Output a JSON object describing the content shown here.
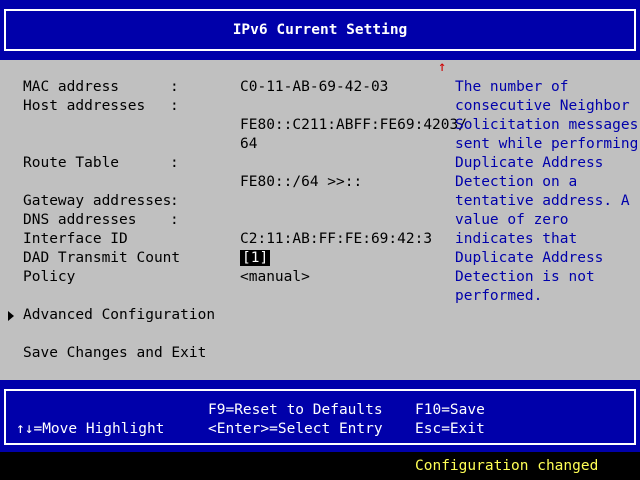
{
  "header": {
    "title": "IPv6 Current Setting"
  },
  "fields": [
    {
      "label": "MAC address",
      "colon": ":",
      "value": "C0-11-AB-69-42-03"
    },
    {
      "label": "Host addresses",
      "colon": ":",
      "value_line1": "FE80::C211:ABFF:FE69:4203/",
      "value_line2": "64"
    },
    {
      "label": "Route Table",
      "colon": ":",
      "value": "FE80::/64 >>::"
    },
    {
      "label": "Gateway addresses",
      "colon": ":"
    },
    {
      "label": "DNS addresses",
      "colon": ":"
    },
    {
      "label": "Interface ID",
      "value": "C2:11:AB:FF:FE:69:42:3"
    },
    {
      "label": "DAD Transmit Count",
      "value": "[1]"
    },
    {
      "label": "Policy",
      "value": "<manual>"
    }
  ],
  "menu": {
    "advanced": "Advanced Configuration",
    "save": "Save Changes and Exit"
  },
  "help": {
    "scroll_indicator": "↑",
    "text": "The number of\nconsecutive Neighbor\nSolicitation messages\nsent while performing\nDuplicate Address\nDetection on a\ntentative address. A\nvalue of zero\nindicates that\nDuplicate Address\nDetection is not\nperformed."
  },
  "keys": {
    "move": "↑↓=Move Highlight",
    "reset": "F9=Reset to Defaults",
    "select": "<Enter>=Select Entry",
    "save": "F10=Save",
    "exit": "Esc=Exit"
  },
  "status": "Configuration changed",
  "colors": {
    "bar": "#0000aa",
    "background": "#c0c0c0",
    "help_text": "#0000aa",
    "status_text": "#ffff55"
  }
}
